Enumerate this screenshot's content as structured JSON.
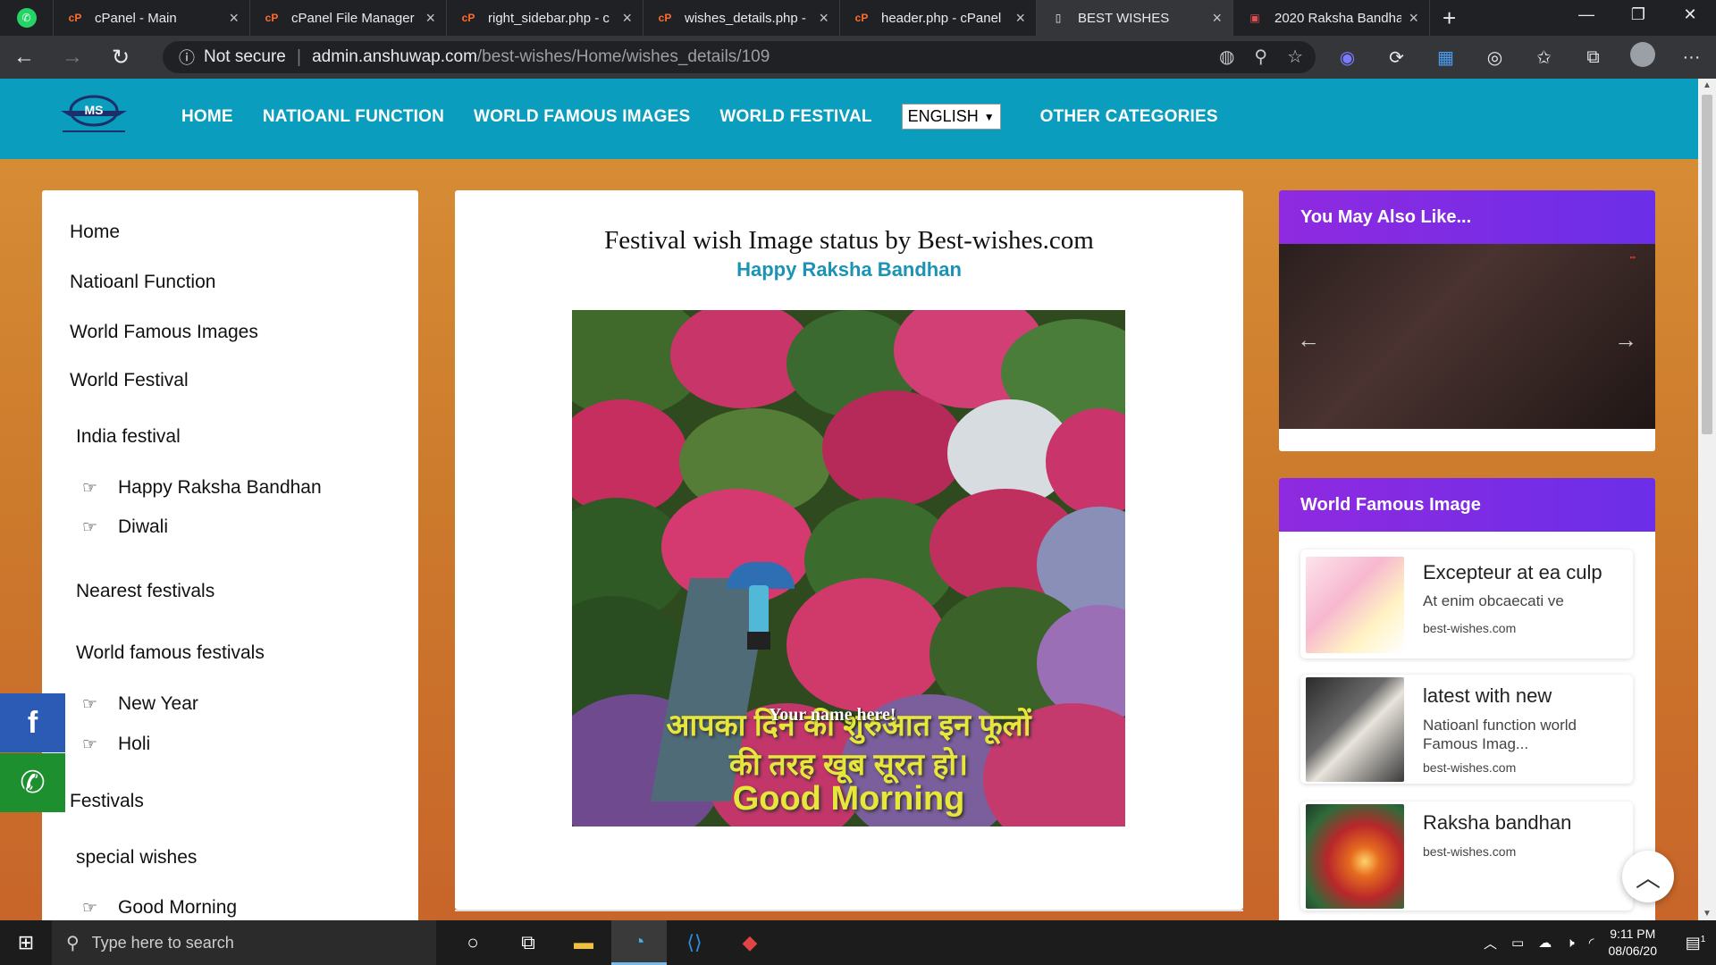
{
  "browser": {
    "tabs": [
      {
        "title": "cPanel - Main",
        "favicon": "cP"
      },
      {
        "title": "cPanel File Manager",
        "favicon": "cP"
      },
      {
        "title": "right_sidebar.php - c",
        "favicon": "cP"
      },
      {
        "title": "wishes_details.php -",
        "favicon": "cP"
      },
      {
        "title": "header.php - cPanel",
        "favicon": "cP"
      },
      {
        "title": "BEST WISHES",
        "favicon": "page"
      },
      {
        "title": "2020 Raksha Bandha",
        "favicon": "gift"
      }
    ],
    "security": "Not secure",
    "url_host": "admin.anshuwap.com",
    "url_path": "/best-wishes/Home/wishes_details/109"
  },
  "site": {
    "nav": [
      "HOME",
      "NATIOANL FUNCTION",
      "WORLD FAMOUS IMAGES",
      "WORLD FESTIVAL"
    ],
    "language": "ENGLISH",
    "other": "OTHER CATEGORIES"
  },
  "left_menu": {
    "home": "Home",
    "national": "Natioanl Function",
    "world_images": "World Famous Images",
    "world_festival": "World Festival",
    "india_festival": "India festival",
    "raksha": "Happy Raksha Bandhan",
    "diwali": "Diwali",
    "nearest": "Nearest festivals",
    "world_famous_festivals": "World famous festivals",
    "new_year": "New Year",
    "holi": "Holi",
    "festivals": "Festivals",
    "special": "special wishes",
    "good_morning": "Good Morning"
  },
  "main": {
    "title": "Festival wish Image status by Best-wishes.com",
    "subtitle": "Happy Raksha Bandhan",
    "overlay_name": "Your name here!",
    "overlay_line1": "आपका दिन की शुरुआत इन फूलों",
    "overlay_line2": "की तरह खूब सूरत हो।",
    "overlay_line3": "Good Morning"
  },
  "right": {
    "also_like": "You May Also Like...",
    "world_famous": "World Famous Image",
    "cards": [
      {
        "title": "Excepteur at ea culp",
        "desc": "At enim obcaecati ve",
        "source": "best-wishes.com"
      },
      {
        "title": "latest with new",
        "desc": "Natioanl function world Famous Imag...",
        "source": "best-wishes.com"
      },
      {
        "title": "Raksha bandhan",
        "desc": "",
        "source": "best-wishes.com"
      }
    ]
  },
  "taskbar": {
    "search_placeholder": "Type here to search",
    "time": "9:11 PM",
    "date": "08/06/20",
    "notifications": "1"
  },
  "colors": {
    "site_nav": "#0a9dbd",
    "page_bg": "#cf7f2a",
    "sidebar_head": "#7a2ce6",
    "subtitle": "#1a93b5"
  }
}
